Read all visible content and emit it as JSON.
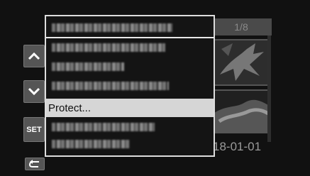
{
  "top_status": "",
  "gallery": {
    "counter": "1/8",
    "date": "18-01-01"
  },
  "side_buttons": {
    "up_icon": "chevron-up-icon",
    "down_icon": "chevron-down-icon",
    "set_label": "SET",
    "back_icon": "return-icon"
  },
  "menu": {
    "items": [
      {
        "label": "",
        "blurred": true
      },
      {
        "label": "",
        "blurred": true
      },
      {
        "label": "",
        "blurred": true
      },
      {
        "label": "",
        "blurred": true
      },
      {
        "label": "Protect...",
        "blurred": false,
        "selected": true
      },
      {
        "label": "",
        "blurred": true
      },
      {
        "label": "",
        "blurred": true
      }
    ]
  },
  "colors": {
    "menu_border": "#dddddd",
    "selected_bg": "#d6d6d6",
    "button_bg": "#555555"
  }
}
